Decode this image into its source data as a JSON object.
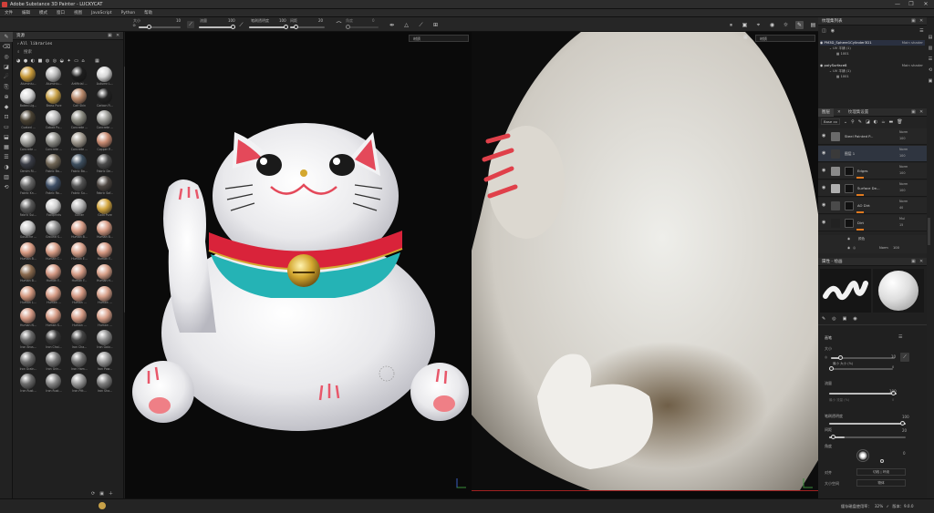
{
  "app": {
    "title": "Adobe Substance 3D Painter - LUCKYCAT"
  },
  "window": {
    "min": "—",
    "max": "❐",
    "close": "✕"
  },
  "menu": [
    "文件",
    "编辑",
    "模式",
    "窗口",
    "视图",
    "JavaScript",
    "Python",
    "帮助"
  ],
  "toolbar": {
    "size_label": "大小",
    "size_value": "10",
    "flow_label": "流量",
    "flow_value": "100",
    "stroke_opacity_label": "笔刷透明度",
    "stroke_opacity_value": "100",
    "spacing_label": "间距",
    "spacing_value": "20",
    "angle_label": "角度",
    "angle_value": "0"
  },
  "assets": {
    "title": "资源",
    "path": "All libraries",
    "search_placeholder": "搜索",
    "items": [
      {
        "label": "Aluminiu...",
        "color": "#c89a3a"
      },
      {
        "label": "Aluminiu...",
        "color": "#b9b9b9"
      },
      {
        "label": "Artificial ...",
        "color": "#1e1e1e"
      },
      {
        "label": "Autumn L...",
        "color": "#d7d7d7"
      },
      {
        "label": "Baked Lig...",
        "color": "#d9d9d9"
      },
      {
        "label": "Brass Pure",
        "color": "#c8a148"
      },
      {
        "label": "Calf Skin",
        "color": "#b8886a"
      },
      {
        "label": "Carbon Fi...",
        "color": "#222222"
      },
      {
        "label": "Coated ...",
        "color": "#4a4233"
      },
      {
        "label": "Cobalt Pu...",
        "color": "#b8b8b8"
      },
      {
        "label": "Concrete ...",
        "color": "#8a8a80"
      },
      {
        "label": "Concrete ...",
        "color": "#9a9a95"
      },
      {
        "label": "Concrete ...",
        "color": "#a4a4a0"
      },
      {
        "label": "Concrete ...",
        "color": "#8e8e88"
      },
      {
        "label": "Concrete ...",
        "color": "#a0998e"
      },
      {
        "label": "Copper P...",
        "color": "#c98b72"
      },
      {
        "label": "Denim Ri...",
        "color": "#3a3d46"
      },
      {
        "label": "Fabric Ba...",
        "color": "#6f6555"
      },
      {
        "label": "Fabric Ba...",
        "color": "#3d4e5e"
      },
      {
        "label": "Fabric De...",
        "color": "#4a4a4a"
      },
      {
        "label": "Fabric Kn...",
        "color": "#666666"
      },
      {
        "label": "Fabric Ro...",
        "color": "#3f4f66"
      },
      {
        "label": "Fabric Su...",
        "color": "#525252"
      },
      {
        "label": "Fabric Sof...",
        "color": "#4d4641"
      },
      {
        "label": "Fabric Sui...",
        "color": "#595959"
      },
      {
        "label": "Footprints",
        "color": "#cfcfcf"
      },
      {
        "label": "Glitter",
        "color": "#b5b5b5"
      },
      {
        "label": "Gold Pure",
        "color": "#d4a740"
      },
      {
        "label": "Gouache ...",
        "color": "#c8c8c8"
      },
      {
        "label": "Ground S...",
        "color": "#8c8c8c"
      },
      {
        "label": "Human B...",
        "color": "#d69c86"
      },
      {
        "label": "Human B...",
        "color": "#d69a83"
      },
      {
        "label": "Human B...",
        "color": "#d89a82"
      },
      {
        "label": "Human C...",
        "color": "#d69b84"
      },
      {
        "label": "Human E...",
        "color": "#d8a08a"
      },
      {
        "label": "Human F...",
        "color": "#d49680"
      },
      {
        "label": "Human B...",
        "color": "#8a6a4e"
      },
      {
        "label": "Human F...",
        "color": "#d29782"
      },
      {
        "label": "Human F...",
        "color": "#d69c86"
      },
      {
        "label": "Human H...",
        "color": "#d8a089"
      },
      {
        "label": "Human L...",
        "color": "#d4987f"
      },
      {
        "label": "Human ...",
        "color": "#d69b85"
      },
      {
        "label": "Human ...",
        "color": "#d49882"
      },
      {
        "label": "Human ...",
        "color": "#d7a08a"
      },
      {
        "label": "Human N...",
        "color": "#d69a85"
      },
      {
        "label": "Human S...",
        "color": "#d49983"
      },
      {
        "label": "Human ...",
        "color": "#d69c86"
      },
      {
        "label": "Human ...",
        "color": "#d8a08a"
      },
      {
        "label": "Iron Brus...",
        "color": "#6a6a6a"
      },
      {
        "label": "Iron Chai...",
        "color": "#3a3a3a"
      },
      {
        "label": "Iron Cha...",
        "color": "#454545"
      },
      {
        "label": "Iron Galv...",
        "color": "#8a8a8a"
      },
      {
        "label": "Iron Grain...",
        "color": "#6e6e6e"
      },
      {
        "label": "Iron Grin...",
        "color": "#7a7a7a"
      },
      {
        "label": "Iron Ham...",
        "color": "#737373"
      },
      {
        "label": "Iron Pow...",
        "color": "#9a9a9a"
      },
      {
        "label": "Iron Rust...",
        "color": "#6b6b6b"
      },
      {
        "label": "Iron Rust...",
        "color": "#858585"
      },
      {
        "label": "Iron Pitt...",
        "color": "#999999"
      },
      {
        "label": "Iron Sha...",
        "color": "#7d7d7d"
      }
    ]
  },
  "viewport": {
    "mode_3d": "材质",
    "mode_2d": "材质"
  },
  "texture_sets": {
    "title": "纹理集列表",
    "sets": [
      {
        "name": "PM3D_Sphere1Cylinder3D1",
        "shader": "Main shader",
        "uv": "UV 平铺 (1)",
        "tile": "1001"
      },
      {
        "name": "polySurface8",
        "shader": "Main shader",
        "uv": "UV 平铺 (1)",
        "tile": "1001"
      }
    ]
  },
  "layers": {
    "tab_layers": "图层",
    "tab_settings": "纹理集设置",
    "base_color": "Base co",
    "items": [
      {
        "name": "Steel Painted P...",
        "blend": "Norm",
        "opacity": "100"
      },
      {
        "name": "图层 1",
        "blend": "Norm",
        "opacity": "100"
      },
      {
        "name": "Edges",
        "blend": "Norm",
        "opacity": "100"
      },
      {
        "name": "Surface De...",
        "blend": "Norm",
        "opacity": "100"
      },
      {
        "name": "AO Dirt",
        "blend": "Norm",
        "opacity": "40"
      },
      {
        "name": "Dirt",
        "blend": "Mul",
        "opacity": "15"
      }
    ],
    "sub_color": "颜色",
    "sub_filter": "Norm",
    "sub_filter_opacity": "100"
  },
  "properties": {
    "title": "属性 - 绘画",
    "brush_section": "画笔",
    "size_label": "大小",
    "size_value": "10",
    "min_size_label": "最小 大小 (%)",
    "min_size_value": "0",
    "flow_label": "流量",
    "flow_value": "100",
    "min_flow_label": "最小 流量 (%)",
    "min_flow_value": "0",
    "opacity_label": "笔刷透明度",
    "opacity_value": "100",
    "spacing_label": "间距",
    "spacing_value": "20",
    "angle_label": "角度",
    "angle_value": "0",
    "align_label": "对齐",
    "align_value": "切线 | 环绕",
    "size_space_label": "大小空间",
    "size_space_value": "物体"
  },
  "status": {
    "memory": "缓存磁盘使用率：",
    "percent": "32%",
    "version": "版本：9.0.0"
  }
}
